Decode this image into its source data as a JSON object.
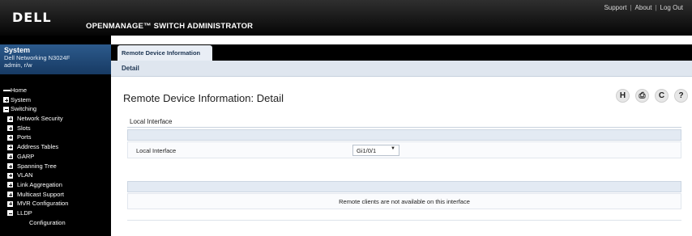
{
  "header": {
    "logo": "DELL",
    "title": "OPENMANAGE™ SWITCH ADMINISTRATOR",
    "links": [
      "Support",
      "About",
      "Log Out"
    ],
    "separator": "|"
  },
  "system": {
    "title": "System",
    "device": "Dell Networking N3024F",
    "user": "admin, r/w"
  },
  "nav": [
    {
      "label": "Home",
      "level": 0,
      "marker": "dash"
    },
    {
      "label": "System",
      "level": 0,
      "marker": "plus"
    },
    {
      "label": "Switching",
      "level": 0,
      "marker": "minus"
    },
    {
      "label": "Network Security",
      "level": 1,
      "marker": "plus"
    },
    {
      "label": "Slots",
      "level": 1,
      "marker": "plus"
    },
    {
      "label": "Ports",
      "level": 1,
      "marker": "plus"
    },
    {
      "label": "Address Tables",
      "level": 1,
      "marker": "plus"
    },
    {
      "label": "GARP",
      "level": 1,
      "marker": "plus"
    },
    {
      "label": "Spanning Tree",
      "level": 1,
      "marker": "plus"
    },
    {
      "label": "VLAN",
      "level": 1,
      "marker": "plus"
    },
    {
      "label": "Link Aggregation",
      "level": 1,
      "marker": "plus"
    },
    {
      "label": "Multicast Support",
      "level": 1,
      "marker": "plus"
    },
    {
      "label": "MVR Configuration",
      "level": 1,
      "marker": "plus"
    },
    {
      "label": "LLDP",
      "level": 1,
      "marker": "minus"
    },
    {
      "label": "Configuration",
      "level": 2,
      "marker": "none"
    }
  ],
  "tabs": {
    "active": "Remote Device Information",
    "subtab": "Detail"
  },
  "page": {
    "title": "Remote Device Information: Detail",
    "tool_icons": [
      "H",
      "⎙",
      "C",
      "?"
    ]
  },
  "local_interface": {
    "section": "Local Interface",
    "field_label": "Local Interface",
    "value": "Gi1/0/1"
  },
  "remote": {
    "message": "Remote clients are not available on this interface"
  }
}
